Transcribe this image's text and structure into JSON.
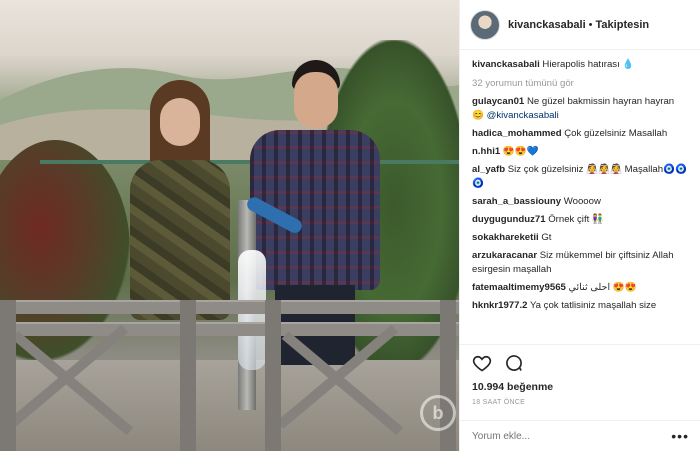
{
  "header": {
    "username": "kivanckasabali",
    "separator": "•",
    "follow_status": "Takiptesin"
  },
  "caption": {
    "username": "kivanckasabali",
    "text": "Hierapolis hatırası 💧"
  },
  "view_all_comments": "32 yorumun tümünü gör",
  "comments": [
    {
      "user": "gulaycan01",
      "text": "Ne güzel bakmissin hayran hayran 😊",
      "mention": "@kivanckasabali"
    },
    {
      "user": "hadica_mohammed",
      "text": "Çok güzelsiniz Masallah",
      "mention": ""
    },
    {
      "user": "n.hhi1",
      "text": "😍😍💙",
      "mention": ""
    },
    {
      "user": "al_yafb",
      "text": "Siz çok güzelsiniz 👰👰👰 Maşallah🧿🧿🧿",
      "mention": ""
    },
    {
      "user": "sarah_a_bassiouny",
      "text": "Woooow",
      "mention": ""
    },
    {
      "user": "duygugunduz71",
      "text": "Örnek çift 👫",
      "mention": ""
    },
    {
      "user": "sokakhareketii",
      "text": "Gt",
      "mention": ""
    },
    {
      "user": "arzukaracanar",
      "text": "Siz mükemmel bir çiftsiniz Allah esirgesin maşallah",
      "mention": ""
    },
    {
      "user": "fatemaaltimemy9565",
      "text": "احلى ثنائي 😍😍",
      "mention": ""
    },
    {
      "user": "hknkr1977.2",
      "text": "Ya çok tatlisiniz maşallah size",
      "mention": ""
    }
  ],
  "actions": {
    "like_icon": "heart-icon",
    "comment_icon": "comment-icon",
    "likes": "10.994 beğenme",
    "time": "18 SAAT ÖNCE"
  },
  "add_comment": {
    "placeholder": "Yorum ekle...",
    "more_icon": "more-options-icon"
  },
  "watermark": "b"
}
